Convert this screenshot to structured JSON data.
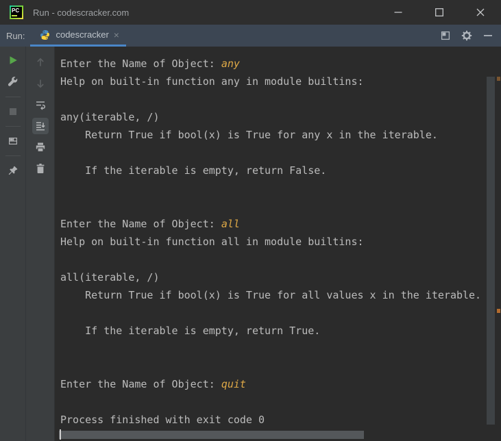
{
  "window": {
    "title": "Run - codescracker.com",
    "app_icon": "pycharm-logo-icon",
    "app_icon_text": "PC",
    "controls": [
      "minimize",
      "maximize",
      "close"
    ]
  },
  "tabbar": {
    "run_label": "Run:",
    "tab": {
      "icon": "python-icon",
      "label": "codescracker",
      "close_glyph": "×"
    },
    "actions": [
      "restore-window-icon",
      "settings-gear-icon",
      "hide-icon"
    ]
  },
  "toolbar": {
    "run_actions": [
      "rerun-icon",
      "settings-wrench-icon",
      "stop-icon",
      "restore-layout-icon",
      "pin-tab-icon"
    ],
    "console_actions": [
      "up-stack-trace-icon",
      "down-stack-trace-icon",
      "soft-wrap-icon",
      "scroll-to-end-icon",
      "print-icon",
      "clear-all-icon"
    ],
    "selected_action": "scroll-to-end-icon"
  },
  "console": {
    "lines": [
      [
        [
          "Enter the Name of Object: ",
          "o"
        ],
        [
          "any",
          "i"
        ]
      ],
      [
        [
          "Help on built-in function any in module builtins:",
          "o"
        ]
      ],
      [],
      [
        [
          "any(iterable, /)",
          "o"
        ]
      ],
      [
        [
          "    Return True if bool(x) is True for any x in the iterable.",
          "o"
        ]
      ],
      [],
      [
        [
          "    If the iterable is empty, return False.",
          "o"
        ]
      ],
      [],
      [],
      [
        [
          "Enter the Name of Object: ",
          "o"
        ],
        [
          "all",
          "i"
        ]
      ],
      [
        [
          "Help on built-in function all in module builtins:",
          "o"
        ]
      ],
      [],
      [
        [
          "all(iterable, /)",
          "o"
        ]
      ],
      [
        [
          "    Return True if bool(x) is True for all values x in the iterable.",
          "o"
        ]
      ],
      [],
      [
        [
          "    If the iterable is empty, return True.",
          "o"
        ]
      ],
      [],
      [],
      [
        [
          "Enter the Name of Object: ",
          "o"
        ],
        [
          "quit",
          "i"
        ]
      ],
      [],
      [
        [
          "Process finished with exit code 0",
          "o"
        ]
      ]
    ]
  },
  "colors": {
    "titlebar_bg": "#2E2E2E",
    "tabbar_bg": "#3C4653",
    "toolbar_bg": "#3B3E40",
    "console_bg": "#2B2B2B",
    "tab_underline_accent": "#4A86C8",
    "output_text": "#BCBCBC",
    "user_input_text": "#DFA947",
    "run_green": "#57A64A"
  }
}
